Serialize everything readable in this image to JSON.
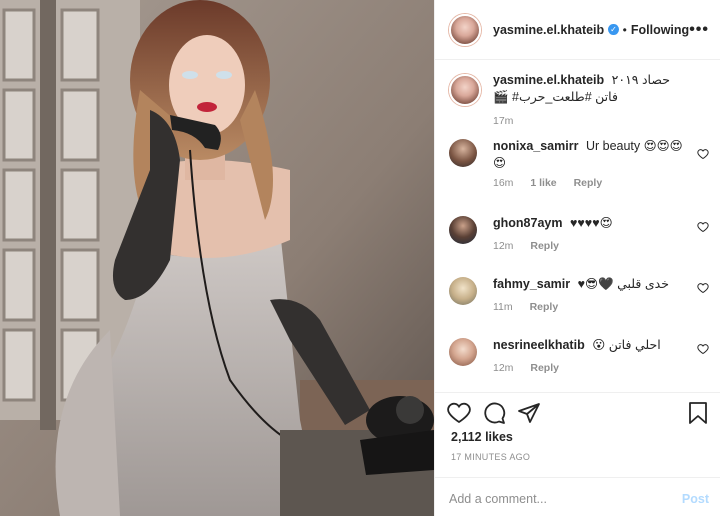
{
  "post": {
    "username": "yasmine.el.khateib",
    "follow_label": "Following",
    "separator": "•",
    "more_label": "•••",
    "verified_mark": "✓"
  },
  "caption": {
    "username": "yasmine.el.khateib",
    "text_line1": "حصاد ٢٠١٩",
    "text_line2": "فاتن #طلعت_حرب# 🎬",
    "time": "17m"
  },
  "comments": [
    {
      "username": "nonixa_samirr",
      "text": "Ur beauty 😍😍😍",
      "text_cont": "😍",
      "time": "16m",
      "likes": "1 like",
      "reply": "Reply"
    },
    {
      "username": "ghon87aym",
      "text": "♥♥♥♥😍",
      "time": "12m",
      "reply": "Reply"
    },
    {
      "username": "fahmy_samir",
      "text": "خدى قلبي 🖤😎♥",
      "time": "11m",
      "reply": "Reply"
    },
    {
      "username": "nesrineelkhatib",
      "text": "احلي فاتن 😮",
      "time": "12m",
      "reply": "Reply"
    }
  ],
  "actions": {
    "likes": "2,112 likes",
    "timestamp": "17 MINUTES AGO"
  },
  "composer": {
    "placeholder": "Add a comment...",
    "post_label": "Post"
  },
  "icons": {
    "like": "heart-icon",
    "comment": "comment-icon",
    "share": "share-icon",
    "save": "bookmark-icon",
    "comment_like": "heart-icon"
  },
  "colors": {
    "verified": "#3897f0",
    "post_disabled": "#b3dbff",
    "muted": "#8e8e8e"
  }
}
